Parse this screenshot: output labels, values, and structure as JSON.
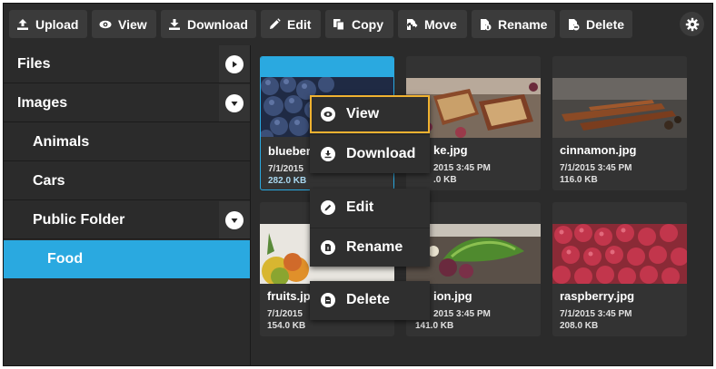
{
  "toolbar": {
    "buttons": [
      {
        "label": "Upload",
        "icon": "upload-icon"
      },
      {
        "label": "View",
        "icon": "eye-icon"
      },
      {
        "label": "Download",
        "icon": "download-icon"
      },
      {
        "label": "Edit",
        "icon": "pencil-icon"
      },
      {
        "label": "Copy",
        "icon": "copy-icon"
      },
      {
        "label": "Move",
        "icon": "move-icon"
      },
      {
        "label": "Rename",
        "icon": "rename-icon"
      },
      {
        "label": "Delete",
        "icon": "delete-icon"
      }
    ],
    "settings_icon": "gear-icon"
  },
  "tree": {
    "items": [
      {
        "label": "Files",
        "state": "collapsed"
      },
      {
        "label": "Images",
        "state": "expanded"
      },
      {
        "label": "Animals"
      },
      {
        "label": "Cars"
      },
      {
        "label": "Public Folder",
        "state": "expanded"
      },
      {
        "label": "Food",
        "selected": true
      }
    ]
  },
  "files": [
    {
      "name": "blueberries.jpg",
      "date": "7/1/2015",
      "size": "282.0 KB",
      "selected": true
    },
    {
      "name": "cake.jpg",
      "date": "7/1/2015 3:45 PM",
      "size": "110.0 KB"
    },
    {
      "name": "cinnamon.jpg",
      "date": "7/1/2015 3:45 PM",
      "size": "116.0 KB"
    },
    {
      "name": "fruits.jpg",
      "date": "7/1/2015",
      "size": "154.0 KB"
    },
    {
      "name": "onion.jpg",
      "date": "7/1/2015 3:45 PM",
      "size": "141.0 KB"
    },
    {
      "name": "raspberry.jpg",
      "date": "7/1/2015 3:45 PM",
      "size": "208.0 KB"
    }
  ],
  "visible_text": {
    "card0_name": "blueber",
    "card0_date": "7/1/2015",
    "card1_name": "ke.jpg",
    "card1_date": "2015 3:45 PM",
    "card1_size": ".0 KB",
    "card3_date": "7/1/2015",
    "card4_name": "ion.jpg",
    "card4_date": "2015 3:45 PM",
    "card4_size": "141.0 KB"
  },
  "context_menu": {
    "items": [
      {
        "label": "View",
        "icon": "eye-icon",
        "focused": true
      },
      {
        "label": "Download",
        "icon": "download-icon"
      },
      {
        "label": "Edit",
        "icon": "pencil-icon"
      },
      {
        "label": "Rename",
        "icon": "rename-icon"
      },
      {
        "label": "Delete",
        "icon": "delete-icon"
      }
    ]
  },
  "colors": {
    "accent": "#2aa9e0",
    "focus": "#f0b230",
    "background": "#2b2b2b",
    "button": "#3b3b3b"
  }
}
